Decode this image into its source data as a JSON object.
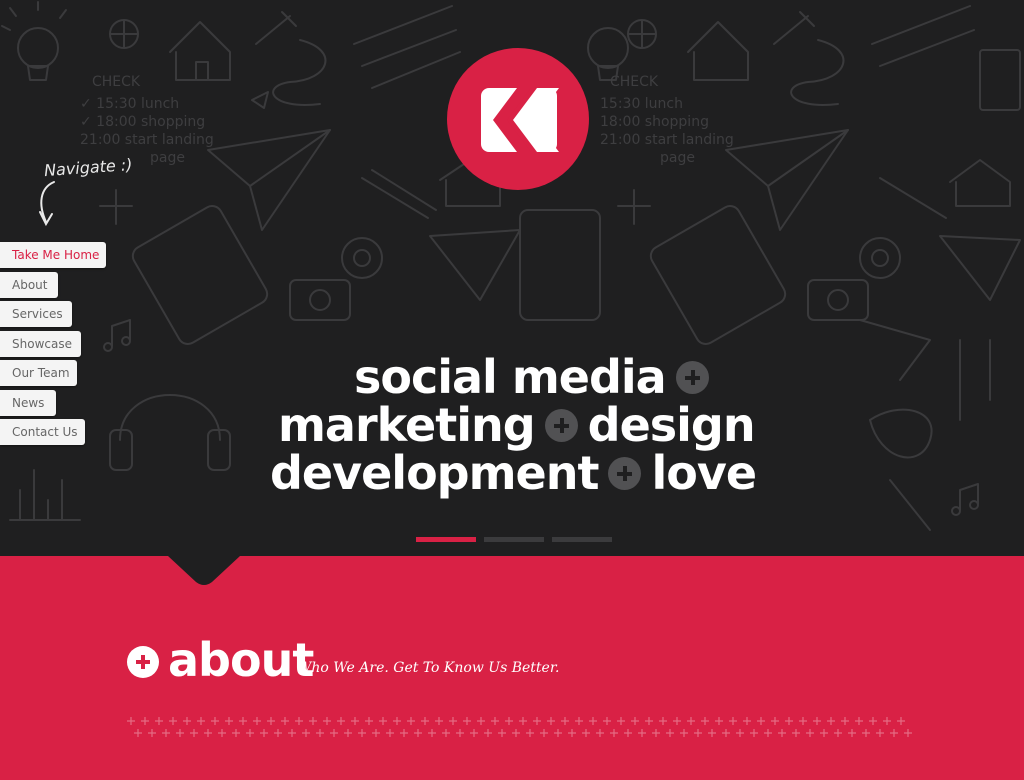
{
  "colors": {
    "accent": "#d92145",
    "hero_bg": "#1f1f20",
    "nav_bg": "#f4f4f4"
  },
  "logo": {
    "icon": "k-chevron-logo"
  },
  "navigate_hint": "Navigate :)",
  "nav": {
    "items": [
      {
        "label": "Take Me Home",
        "active": true
      },
      {
        "label": "About"
      },
      {
        "label": "Services"
      },
      {
        "label": "Showcase"
      },
      {
        "label": "Our Team"
      },
      {
        "label": "News"
      },
      {
        "label": "Contact Us"
      }
    ]
  },
  "hero": {
    "line1": "social media",
    "line2a": "marketing",
    "line2b": "design",
    "line3a": "development",
    "line3b": "love",
    "slides": {
      "count": 3,
      "active": 0
    }
  },
  "about": {
    "title": "about",
    "subtitle": "Who We Are. Get To Know Us Better."
  }
}
